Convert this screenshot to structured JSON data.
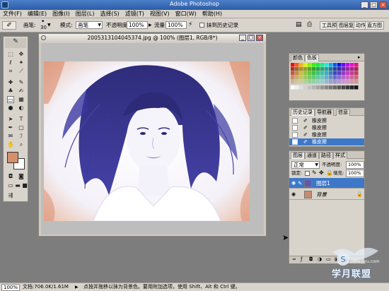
{
  "app": {
    "title": "Adobe Photoshop"
  },
  "menu": [
    "文件(F)",
    "编辑(E)",
    "图像(I)",
    "图层(L)",
    "选择(S)",
    "滤镜(T)",
    "视图(V)",
    "窗口(W)",
    "帮助(H)"
  ],
  "options": {
    "brush_label": "画笔:",
    "brush_size": "30",
    "mode_label": "模式:",
    "mode_value": "画笔",
    "opacity_label": "不透明度:",
    "opacity_value": "100%",
    "flow_label": "流量:",
    "flow_value": "100%",
    "history_erase_label": "抹到历史记录",
    "tabs": [
      "工具预设",
      "图层复合",
      "动作",
      "直方图"
    ]
  },
  "document": {
    "title": "2005313104045374.jpg @ 100% (图层1, RGB/8*)"
  },
  "color_panel": {
    "tabs": [
      "颜色",
      "色板"
    ]
  },
  "history_panel": {
    "tabs": [
      "历史记录",
      "导航器",
      "信息"
    ],
    "items": [
      "橡皮擦",
      "橡皮擦",
      "橡皮擦",
      "橡皮擦"
    ]
  },
  "layers_panel": {
    "tabs": [
      "图层",
      "通道",
      "路径",
      "样式"
    ],
    "blend_mode": "正常",
    "opacity_label": "不透明度:",
    "opacity_value": "100%",
    "lock_label": "锁定:",
    "fill_label": "填充:",
    "fill_value": "100%",
    "layers": [
      {
        "name": "图层1",
        "selected": true
      },
      {
        "name": "背景",
        "selected": false
      }
    ]
  },
  "status": {
    "zoom": "100%",
    "doc_info": "文档:706.0K/1.61M",
    "hint": "点按并拖移以抹为背景色。要用附加选项，使用 Shift、Alt 和 Ctrl 键。"
  },
  "watermark": {
    "text": "学月联盟",
    "site": "www.jiyu.com"
  },
  "colors": {
    "accent": "#3a6ea5",
    "foreground_swatch": "#d68f6b",
    "background_swatch": "#ffffff",
    "selection": "#3d78c8"
  },
  "icons": [
    "brush-icon",
    "move-tool-icon",
    "lasso-tool-icon",
    "eraser-tool-icon",
    "eye-icon",
    "eraser-history-icon",
    "trash-icon"
  ]
}
